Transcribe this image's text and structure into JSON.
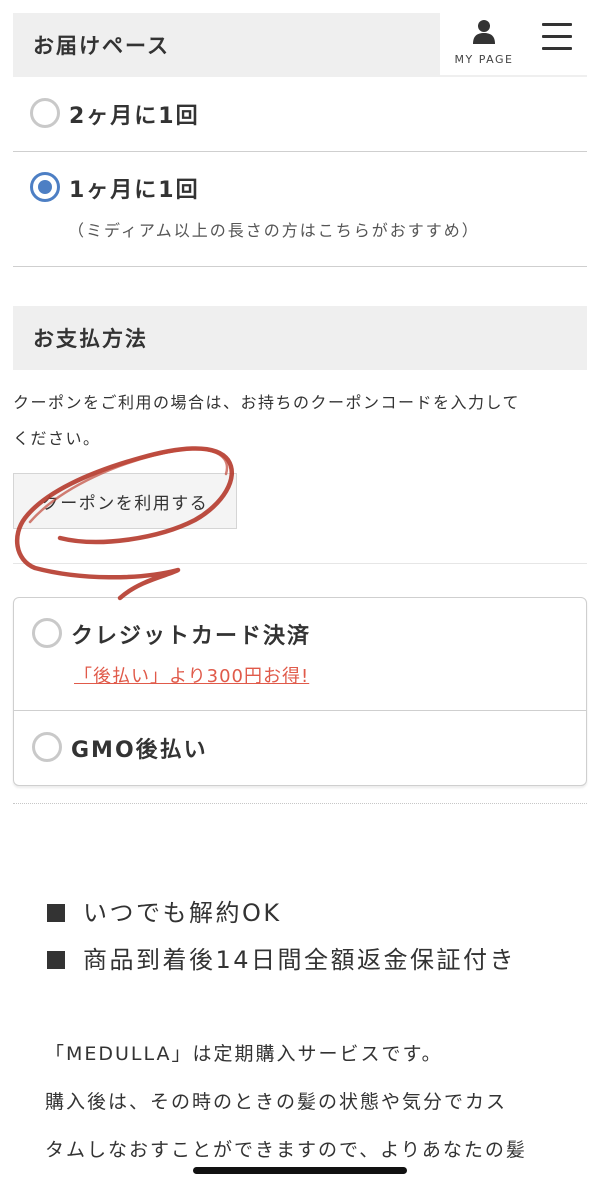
{
  "delivery": {
    "title": "お届けペース",
    "options": [
      {
        "label": "2ヶ月に1回",
        "checked": false
      },
      {
        "label": "1ヶ月に1回",
        "checked": true,
        "note": "（ミディアム以上の長さの方はこちらがおすすめ）"
      }
    ]
  },
  "header": {
    "mypage_label": "MY PAGE",
    "icons": {
      "mypage": "user-icon",
      "menu": "hamburger-menu-icon"
    }
  },
  "payment": {
    "title": "お支払方法",
    "coupon_text_line1": "クーポンをご利用の場合は、お持ちのクーポンコードを入力して",
    "coupon_text_line2": "ください。",
    "coupon_button": "クーポンを利用する",
    "methods": [
      {
        "label": "クレジットカード決済",
        "promo": "「後払い」より300円お得!",
        "checked": false
      },
      {
        "label": "GMO後払い",
        "checked": false
      }
    ]
  },
  "features": [
    "いつでも解約OK",
    "商品到着後14日間全額返金保証付き"
  ],
  "description": [
    "「MEDULLA」は定期購入サービスです。",
    "購入後は、その時のときの髪の状態や気分でカス",
    "タムしなおすことができますので、よりあなたの髪"
  ],
  "colors": {
    "accent": "#4d7fc4",
    "promo": "#e05a4a",
    "header_bg": "#efefef",
    "scribble": "#b53a2c"
  }
}
